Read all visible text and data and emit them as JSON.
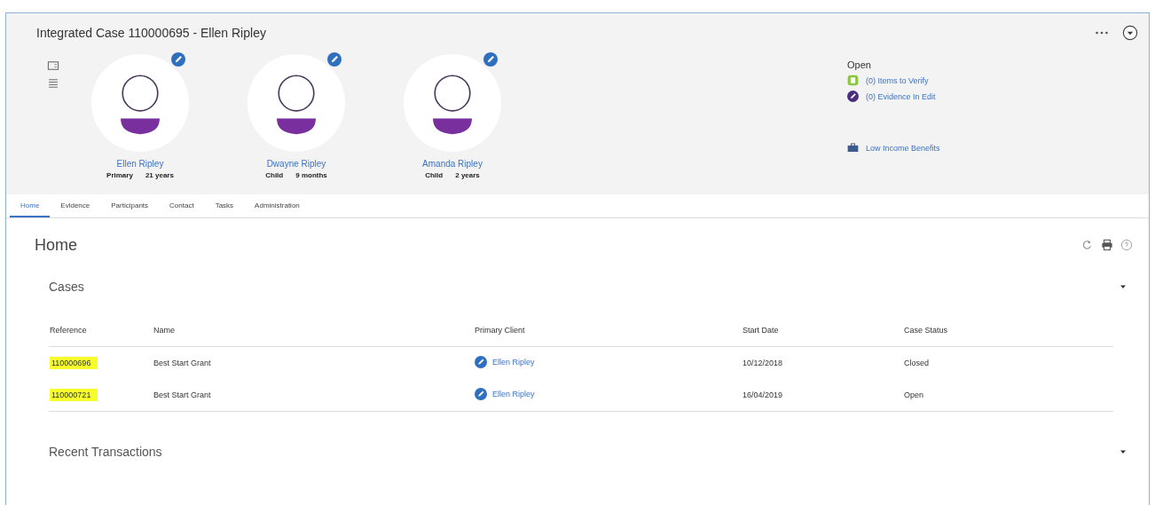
{
  "window": {
    "title": "Integrated Case 110000695 - Ellen Ripley"
  },
  "participants": [
    {
      "name": "Ellen Ripley",
      "role": "Primary",
      "age": "21 years"
    },
    {
      "name": "Dwayne Ripley",
      "role": "Child",
      "age": "9 months"
    },
    {
      "name": "Amanda Ripley",
      "role": "Child",
      "age": "2 years"
    }
  ],
  "open_panel": {
    "heading": "Open",
    "items": [
      {
        "kind": "verify",
        "label": "(0) Items to Verify"
      },
      {
        "kind": "edit",
        "label": "(0) Evidence In Edit"
      }
    ],
    "program": "Low Income Benefits"
  },
  "tabs": [
    {
      "label": "Home",
      "selected": true
    },
    {
      "label": "Evidence",
      "selected": false
    },
    {
      "label": "Participants",
      "selected": false
    },
    {
      "label": "Contact",
      "selected": false
    },
    {
      "label": "Tasks",
      "selected": false
    },
    {
      "label": "Administration",
      "selected": false
    }
  ],
  "page_title": "Home",
  "cases": {
    "title": "Cases",
    "expanded": true,
    "columns": [
      "Reference",
      "Name",
      "Primary Client",
      "Start Date",
      "Case Status"
    ],
    "rows": [
      {
        "reference": "110000696",
        "highlighted": true,
        "name": "Best Start Grant",
        "client": "Ellen Ripley",
        "start_date": "10/12/2018",
        "status": "Closed"
      },
      {
        "reference": "110000721",
        "highlighted": true,
        "name": "Best Start Grant",
        "client": "Ellen Ripley",
        "start_date": "16/04/2019",
        "status": "Open"
      }
    ]
  },
  "recent_transactions": {
    "title": "Recent Transactions",
    "expanded": true
  }
}
